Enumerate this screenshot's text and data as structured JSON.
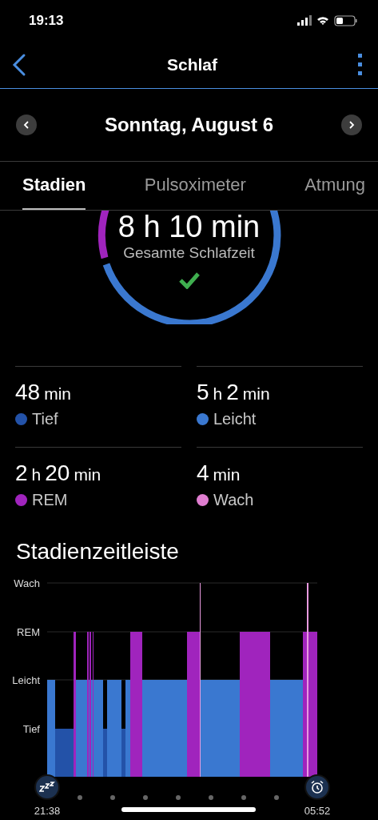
{
  "status_bar": {
    "time": "19:13"
  },
  "header": {
    "title": "Schlaf"
  },
  "date_nav": {
    "label": "Sonntag, August 6"
  },
  "tabs": [
    {
      "label": "Stadien",
      "selected": true
    },
    {
      "label": "Pulsoximeter",
      "selected": false
    },
    {
      "label": "Atmung",
      "selected": false
    }
  ],
  "total": {
    "value": "8 h 10 min",
    "label": "Gesamte Schlafzeit"
  },
  "stages": [
    {
      "parts": [
        {
          "n": "48",
          "u": "min"
        }
      ],
      "label": "Tief",
      "color": "#2352a8"
    },
    {
      "parts": [
        {
          "n": "5",
          "u": "h"
        },
        {
          "n": "2",
          "u": "min"
        }
      ],
      "label": "Leicht",
      "color": "#3a78d0"
    },
    {
      "parts": [
        {
          "n": "2",
          "u": "h"
        },
        {
          "n": "20",
          "u": "min"
        }
      ],
      "label": "REM",
      "color": "#a024bd"
    },
    {
      "parts": [
        {
          "n": "4",
          "u": "min"
        }
      ],
      "label": "Wach",
      "color": "#e07ed0"
    }
  ],
  "timeline": {
    "title": "Stadienzeitleiste",
    "levels": [
      "Wach",
      "REM",
      "Leicht",
      "Tief"
    ],
    "start": "21:38",
    "end": "05:52"
  }
}
